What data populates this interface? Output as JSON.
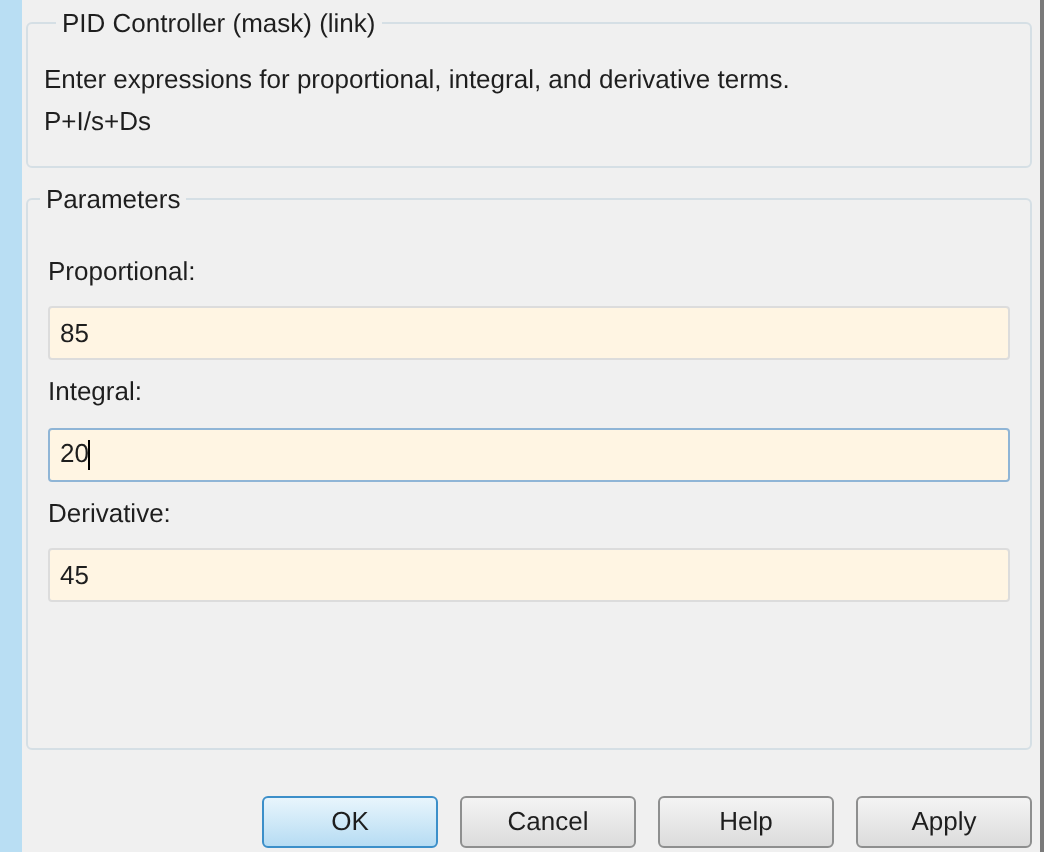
{
  "description_group": {
    "title": "PID Controller (mask) (link)",
    "lines": [
      "Enter expressions for proportional, integral, and derivative terms.",
      "P+I/s+Ds"
    ]
  },
  "parameters_group": {
    "title": "Parameters",
    "fields": [
      {
        "label": "Proportional:",
        "value": "85",
        "focused": false
      },
      {
        "label": "Integral:",
        "value": "20",
        "focused": true
      },
      {
        "label": "Derivative:",
        "value": "45",
        "focused": false
      }
    ]
  },
  "buttons": [
    {
      "label": "OK",
      "default": true
    },
    {
      "label": "Cancel",
      "default": false
    },
    {
      "label": "Help",
      "default": false
    },
    {
      "label": "Apply",
      "default": false
    }
  ]
}
